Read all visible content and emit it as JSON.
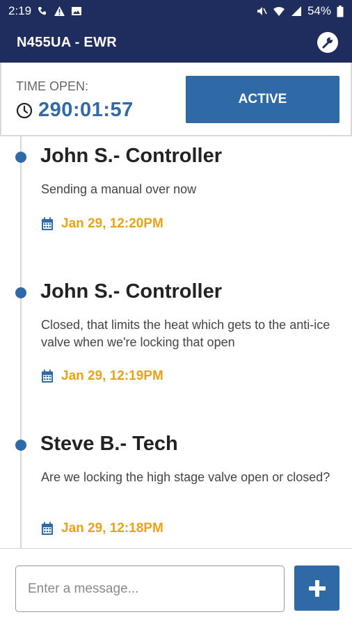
{
  "status_bar": {
    "time": "2:19",
    "battery": "54%",
    "left_icons": [
      "call-icon",
      "warning-icon",
      "image-icon"
    ],
    "right_icons": [
      "mute-icon",
      "wifi-icon",
      "signal-icon",
      "battery-icon"
    ]
  },
  "header": {
    "title": "N455UA - EWR",
    "action_icon": "wrench-icon"
  },
  "time_panel": {
    "label": "TIME OPEN:",
    "value": "290:01:57",
    "status_button": "ACTIVE"
  },
  "messages": [
    {
      "author": "John S.- Controller",
      "text": "Sending a manual over now",
      "date": "Jan 29, 12:20PM"
    },
    {
      "author": "John S.- Controller",
      "text": "Closed, that limits the heat which gets to the anti-ice valve when we're locking that open",
      "date": "Jan 29, 12:19PM"
    },
    {
      "author": "Steve B.- Tech",
      "text": "Are we locking the high stage valve open or closed?",
      "date": "Jan 29, 12:18PM"
    }
  ],
  "composer": {
    "placeholder": "Enter a message...",
    "value": "",
    "add_icon": "plus-icon"
  },
  "colors": {
    "header_bg": "#1e2d5e",
    "accent": "#2f6aa6",
    "date": "#e8a317"
  }
}
